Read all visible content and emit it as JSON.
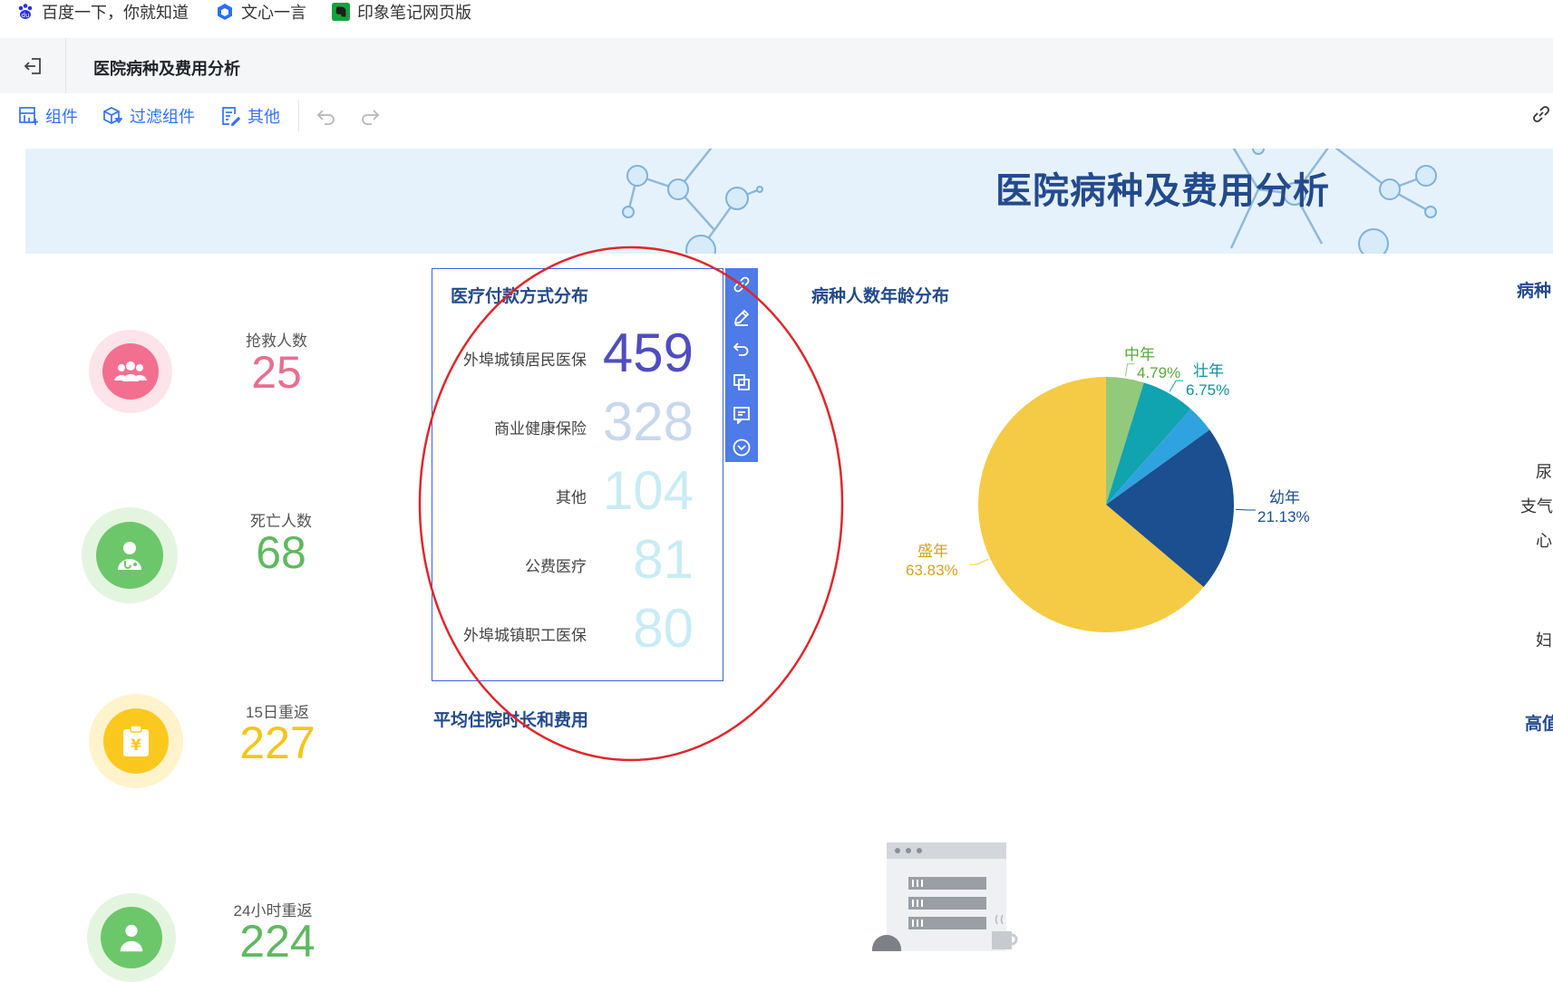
{
  "bookmarks": [
    {
      "label": "百度一下，你就知道",
      "icon": "baidu-paw-icon"
    },
    {
      "label": "文心一言",
      "icon": "wenxin-cube-icon"
    },
    {
      "label": "印象笔记网页版",
      "icon": "evernote-elephant-icon"
    }
  ],
  "header": {
    "title": "医院病种及费用分析"
  },
  "toolbar": {
    "components": "组件",
    "filter_components": "过滤组件",
    "other": "其他"
  },
  "banner": {
    "title": "医院病种及费用分析"
  },
  "kpis": [
    {
      "label": "抢救人数",
      "value": "25",
      "color": "#e86f8f",
      "icon": "people-group-icon"
    },
    {
      "label": "死亡人数",
      "value": "68",
      "color": "#5fb95f",
      "icon": "doctor-icon"
    },
    {
      "label": "15日重返",
      "value": "227",
      "color": "#f5c518",
      "icon": "clipboard-yen-icon"
    },
    {
      "label": "24小时重返",
      "value": "224",
      "color": "#5fb95f",
      "icon": "doctor-icon"
    }
  ],
  "payment": {
    "title": "医疗付款方式分布",
    "items": [
      {
        "label": "外埠城镇居民医保",
        "value": "459",
        "color": "#4f4dc0"
      },
      {
        "label": "商业健康保险",
        "value": "328",
        "color": "#c8d8ec"
      },
      {
        "label": "其他",
        "value": "104",
        "color": "#c9ecf4"
      },
      {
        "label": "公费医疗",
        "value": "81",
        "color": "#c9ecf4"
      },
      {
        "label": "外埠城镇职工医保",
        "value": "80",
        "color": "#c9ecf4"
      }
    ]
  },
  "sections": {
    "age_distribution": "病种人数年龄分布",
    "avg_stay": "平均住院时长和费用",
    "right_top_partial": "病种",
    "right_bottom_partial": "高值"
  },
  "chart_data": {
    "type": "pie",
    "title": "病种人数年龄分布",
    "slices": [
      {
        "name": "中年",
        "value": 4.79,
        "label": "4.79%",
        "color": "#93c97a"
      },
      {
        "name": "壮年",
        "value": 6.75,
        "label": "6.75%",
        "color": "#10a3b0"
      },
      {
        "name": "",
        "value": 3.5,
        "label": "",
        "color": "#2fa3df"
      },
      {
        "name": "幼年",
        "value": 21.13,
        "label": "21.13%",
        "color": "#1b4f8f"
      },
      {
        "name": "盛年",
        "value": 63.83,
        "label": "63.83%",
        "color": "#f5cb45"
      }
    ]
  },
  "right_edge_texts": [
    "尿",
    "支气",
    "心",
    "妇"
  ],
  "colors": {
    "accent": "#3370ff",
    "title_blue": "#234a8c",
    "annotation_red": "#e0262b",
    "toolbar_blue": "#4e7be8"
  }
}
